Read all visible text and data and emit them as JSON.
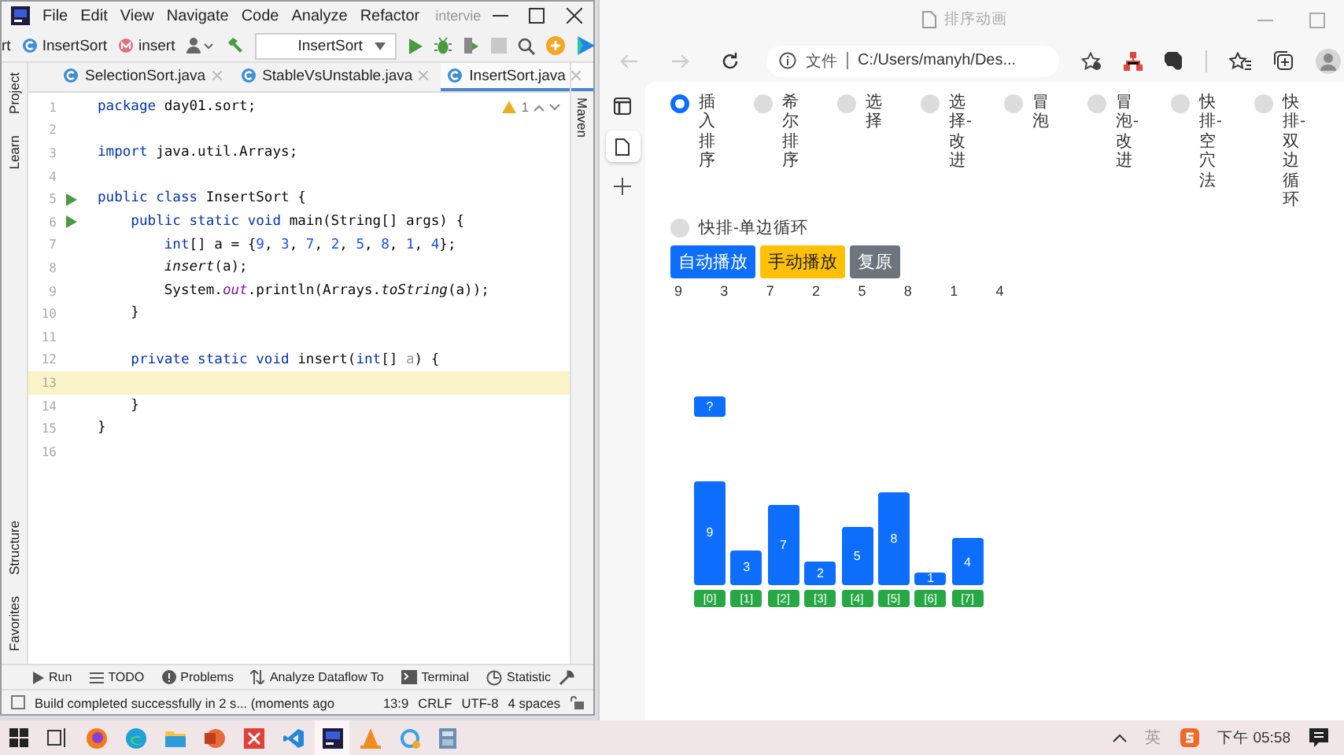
{
  "ide": {
    "title": "intervie",
    "menu": [
      "File",
      "Edit",
      "View",
      "Navigate",
      "Code",
      "Analyze",
      "Refactor"
    ],
    "breadcrumb": [
      {
        "label": "rt",
        "kind": "plain"
      },
      {
        "label": "InsertSort",
        "kind": "class"
      },
      {
        "label": "insert",
        "kind": "method"
      }
    ],
    "run_config": "InsertSort",
    "tabs": [
      {
        "label": "SelectionSort.java",
        "selected": false
      },
      {
        "label": "StableVsUnstable.java",
        "selected": false
      },
      {
        "label": "InsertSort.java",
        "selected": true
      }
    ],
    "left_tools_top": [
      "Project",
      "Learn"
    ],
    "left_tools_bottom": [
      "Structure",
      "Favorites"
    ],
    "right_tools": [
      "Maven"
    ],
    "warnings": "1",
    "lines": [
      {
        "number": "1",
        "run": false,
        "current": false,
        "tokens": [
          {
            "t": "package",
            "kind": "kw"
          },
          {
            "t": " day01.sort;",
            "kind": "txt"
          }
        ]
      },
      {
        "number": "2",
        "run": false,
        "current": false
      },
      {
        "number": "3",
        "run": false,
        "current": false,
        "tokens": [
          {
            "t": "import",
            "kind": "kw"
          },
          {
            "t": " java.util.Arrays;",
            "kind": "txt"
          }
        ]
      },
      {
        "number": "4",
        "run": false,
        "current": false
      },
      {
        "number": "5",
        "run": true,
        "current": false,
        "tokens": [
          {
            "t": "public class",
            "kind": "kw"
          },
          {
            "t": " InsertSort {",
            "kind": "txt"
          }
        ]
      },
      {
        "number": "6",
        "run": true,
        "current": false,
        "tokens": [
          {
            "t": "    public static void",
            "kind": "kw"
          },
          {
            "t": " main(String[] args) {",
            "kind": "txt"
          }
        ]
      },
      {
        "number": "7",
        "run": false,
        "current": false,
        "tokens": [
          {
            "t": "        int",
            "kind": "kw"
          },
          {
            "t": "[] a = {",
            "kind": "txt"
          },
          {
            "t": "9",
            "kind": "num"
          },
          {
            "t": ", ",
            "kind": "txt"
          },
          {
            "t": "3",
            "kind": "num"
          },
          {
            "t": ", ",
            "kind": "txt"
          },
          {
            "t": "7",
            "kind": "num"
          },
          {
            "t": ", ",
            "kind": "txt"
          },
          {
            "t": "2",
            "kind": "num"
          },
          {
            "t": ", ",
            "kind": "txt"
          },
          {
            "t": "5",
            "kind": "num"
          },
          {
            "t": ", ",
            "kind": "txt"
          },
          {
            "t": "8",
            "kind": "num"
          },
          {
            "t": ", ",
            "kind": "txt"
          },
          {
            "t": "1",
            "kind": "num"
          },
          {
            "t": ", ",
            "kind": "txt"
          },
          {
            "t": "4",
            "kind": "num"
          },
          {
            "t": "};",
            "kind": "txt"
          }
        ]
      },
      {
        "number": "8",
        "run": false,
        "current": false,
        "tokens": [
          {
            "t": "        insert",
            "kind": "it"
          },
          {
            "t": "(a);",
            "kind": "txt"
          }
        ]
      },
      {
        "number": "9",
        "run": false,
        "current": false,
        "tokens": [
          {
            "t": "        System.",
            "kind": "txt"
          },
          {
            "t": "out",
            "kind": "field"
          },
          {
            "t": ".println(Arrays.",
            "kind": "txt"
          },
          {
            "t": "toString",
            "kind": "it"
          },
          {
            "t": "(a));",
            "kind": "txt"
          }
        ]
      },
      {
        "number": "10",
        "run": false,
        "current": false,
        "tokens": [
          {
            "t": "    }",
            "kind": "txt"
          }
        ]
      },
      {
        "number": "11",
        "run": false,
        "current": false
      },
      {
        "number": "12",
        "run": false,
        "current": false,
        "tokens": [
          {
            "t": "    private static void",
            "kind": "kw"
          },
          {
            "t": " insert(",
            "kind": "txt"
          },
          {
            "t": "int",
            "kind": "kw"
          },
          {
            "t": "[] ",
            "kind": "txt"
          },
          {
            "t": "a",
            "kind": "unused"
          },
          {
            "t": ") {",
            "kind": "txt"
          }
        ]
      },
      {
        "number": "13",
        "run": false,
        "current": true
      },
      {
        "number": "14",
        "run": false,
        "current": false,
        "tokens": [
          {
            "t": "    }",
            "kind": "txt"
          }
        ]
      },
      {
        "number": "15",
        "run": false,
        "current": false,
        "tokens": [
          {
            "t": "}",
            "kind": "txt"
          }
        ]
      },
      {
        "number": "16",
        "run": false,
        "current": false
      }
    ],
    "bottom_tools": [
      {
        "label": "Run",
        "kind": "run"
      },
      {
        "label": "TODO",
        "kind": "todo"
      },
      {
        "label": "Problems",
        "kind": "problems"
      },
      {
        "label": "Analyze Dataflow To",
        "kind": "dataflow"
      },
      {
        "label": "Terminal",
        "kind": "terminal"
      },
      {
        "label": "Statistic",
        "kind": "statistic"
      }
    ],
    "status": {
      "message": "Build completed successfully in 2 s... (moments ago",
      "position": "13:9",
      "line_separator": "CRLF",
      "encoding": "UTF-8",
      "indent": "4 spaces"
    }
  },
  "browser": {
    "title": "排序动画",
    "address": {
      "scheme": "文件",
      "url": "C:/Users/manyh/Des..."
    },
    "algorithms": [
      {
        "label": "插入排序",
        "selected": true
      },
      {
        "label": "希尔排序",
        "selected": false
      },
      {
        "label": "选择",
        "selected": false
      },
      {
        "label": "选择-改进",
        "selected": false
      },
      {
        "label": "冒泡",
        "selected": false
      },
      {
        "label": "冒泡-改进",
        "selected": false
      },
      {
        "label": "快排-空穴法",
        "selected": false
      },
      {
        "label": "快排-双边循环",
        "selected": false
      },
      {
        "label": "快排-单边循环",
        "selected": false
      }
    ],
    "buttons": [
      {
        "label": "自动播放",
        "kind": "primary"
      },
      {
        "label": "手动播放",
        "kind": "warning"
      },
      {
        "label": "复原",
        "kind": "secondary"
      }
    ],
    "values": [
      "9",
      "3",
      "7",
      "2",
      "5",
      "8",
      "1",
      "4"
    ],
    "temp": "?",
    "bars": [
      {
        "value": "9",
        "index": "[0]"
      },
      {
        "value": "3",
        "index": "[1]"
      },
      {
        "value": "7",
        "index": "[2]"
      },
      {
        "value": "2",
        "index": "[3]"
      },
      {
        "value": "5",
        "index": "[4]"
      },
      {
        "value": "8",
        "index": "[5]"
      },
      {
        "value": "1",
        "index": "[6]"
      },
      {
        "value": "4",
        "index": "[7]"
      }
    ]
  },
  "taskbar": {
    "ime": "英",
    "time": "下午 05:58"
  }
}
